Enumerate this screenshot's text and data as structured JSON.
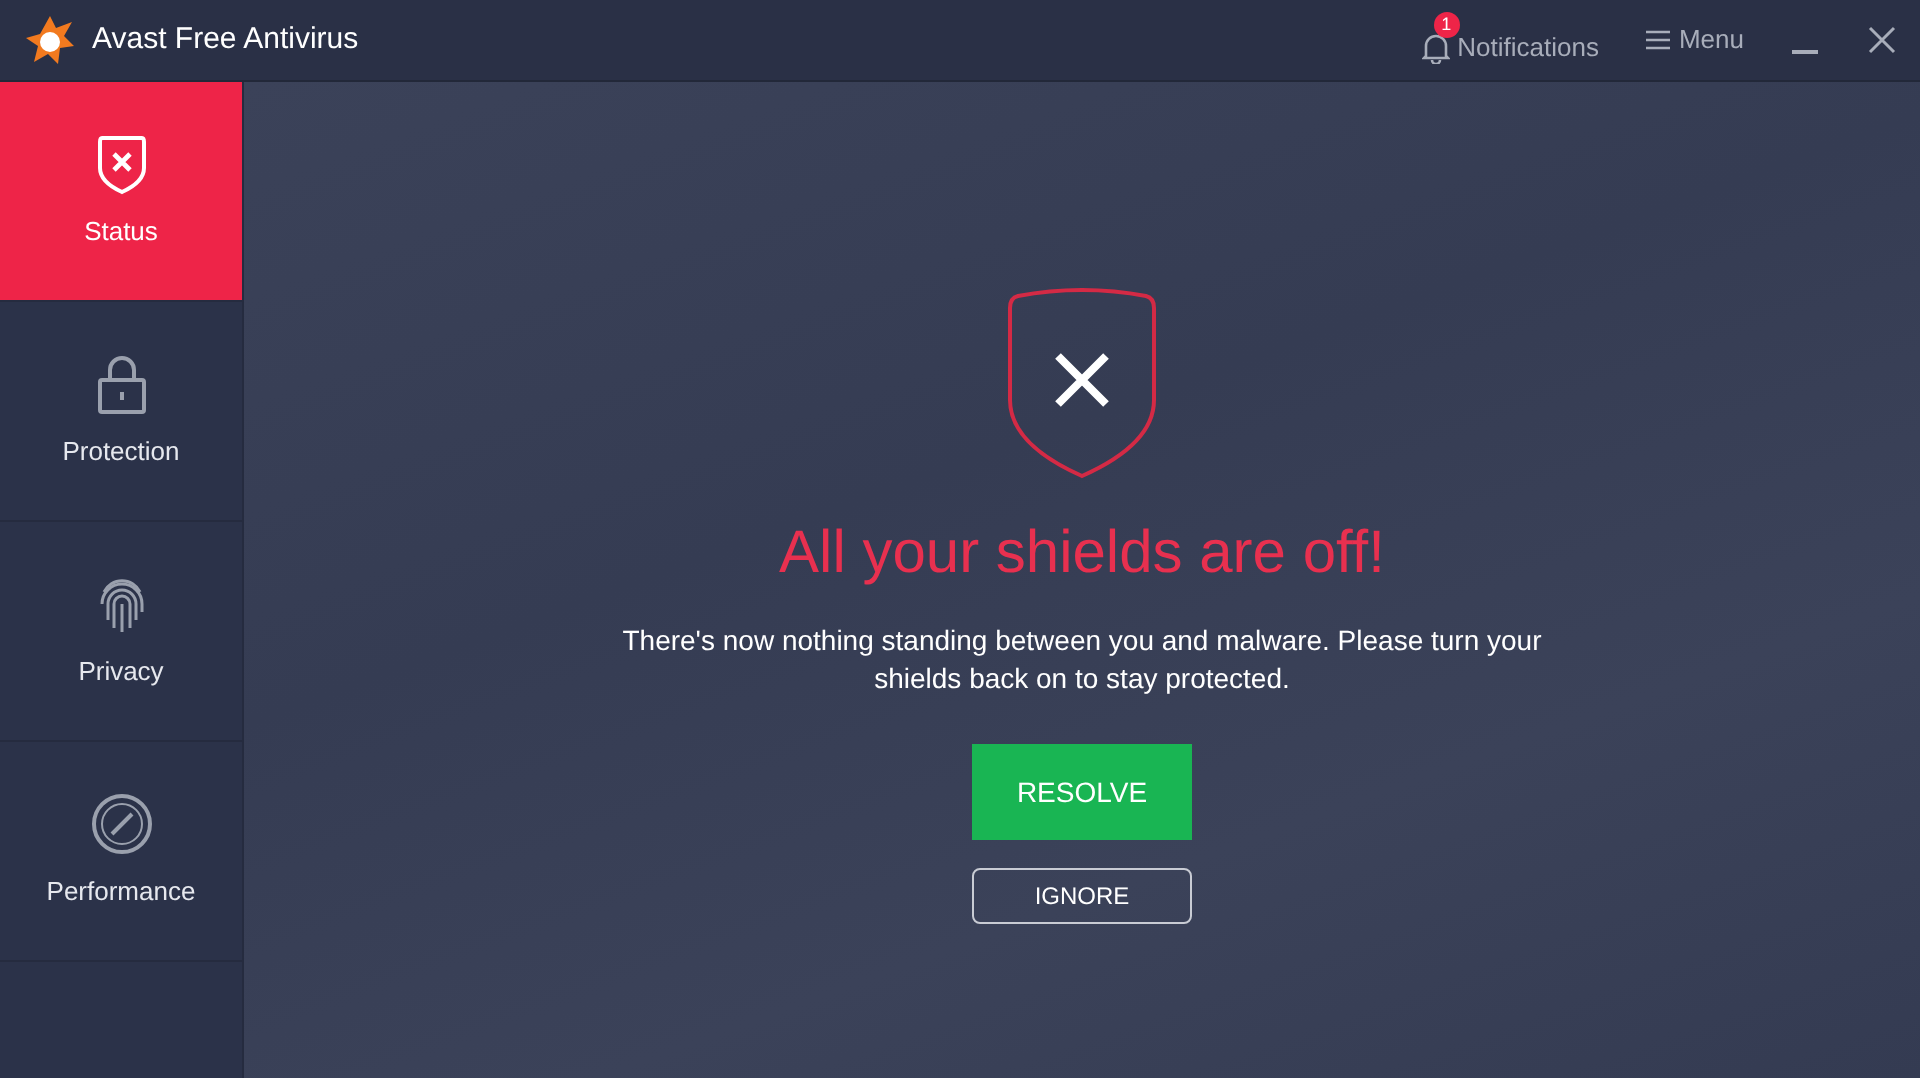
{
  "window": {
    "title": "Avast Free Antivirus"
  },
  "header": {
    "notifications": {
      "label": "Notifications",
      "badge": "1"
    },
    "menu": {
      "label": "Menu"
    }
  },
  "sidebar": {
    "items": [
      {
        "label": "Status",
        "kind": "status",
        "selected": true
      },
      {
        "label": "Protection",
        "kind": "protection",
        "selected": false
      },
      {
        "label": "Privacy",
        "kind": "privacy",
        "selected": false
      },
      {
        "label": "Performance",
        "kind": "performance",
        "selected": false
      }
    ]
  },
  "alert": {
    "title": "All your shields are off!",
    "message": "There's now nothing standing between you and malware. Please turn your shields back on to stay protected.",
    "primary_button": "RESOLVE",
    "secondary_button": "IGNORE"
  }
}
